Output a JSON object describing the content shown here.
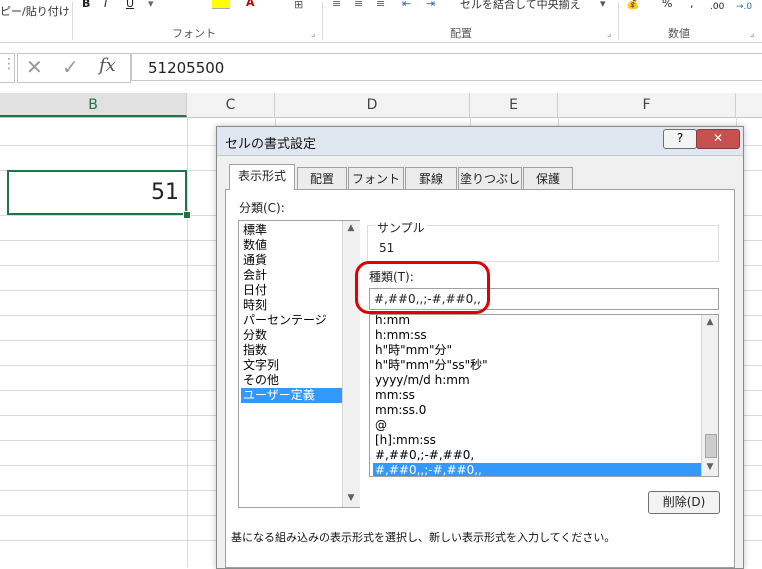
{
  "ribbon": {
    "clipboard_paste_format": "ピー/貼り付け",
    "bold": "B",
    "italic": "I",
    "underline": "U",
    "font_color_letter": "A",
    "font_group": "フォント",
    "alignment_group": "配置",
    "merge_center": "セルを結合して中央揃え",
    "number_group": "数値",
    "percent": "%",
    "decimal_decrease": ".00",
    "decimal_increase": "→.0",
    "launcher": "⌟"
  },
  "formula_bar": {
    "value": "51205500",
    "fx": "fx"
  },
  "sheet": {
    "columns": [
      "B",
      "C",
      "D",
      "E",
      "F"
    ],
    "active_cell_value": "51",
    "accent_color": "#217346"
  },
  "dialog": {
    "title": "セルの書式設定",
    "help": "?",
    "close": "✕",
    "tabs": [
      "表示形式",
      "配置",
      "フォント",
      "罫線",
      "塗りつぶし",
      "保護"
    ],
    "category_label": "分類(C):",
    "categories": [
      "標準",
      "数値",
      "通貨",
      "会計",
      "日付",
      "時刻",
      "パーセンテージ",
      "分数",
      "指数",
      "文字列",
      "その他",
      "ユーザー定義"
    ],
    "sample_label": "サンプル",
    "sample_value": "51",
    "type_label": "種類(T):",
    "type_value": "#,##0,,;-#,##0,,",
    "formats": [
      "h:mm",
      "h:mm:ss",
      "h\"時\"mm\"分\"",
      "h\"時\"mm\"分\"ss\"秒\"",
      "yyyy/m/d h:mm",
      "mm:ss",
      "mm:ss.0",
      "@",
      "[h]:mm:ss",
      "#,##0,;-#,##0,",
      "#,##0,,;-#,##0,,"
    ],
    "delete_button": "削除(D)",
    "hint": "基になる組み込みの表示形式を選択し、新しい表示形式を入力してください。",
    "highlight_color": "#e00000",
    "selection_color": "#3399ff"
  }
}
